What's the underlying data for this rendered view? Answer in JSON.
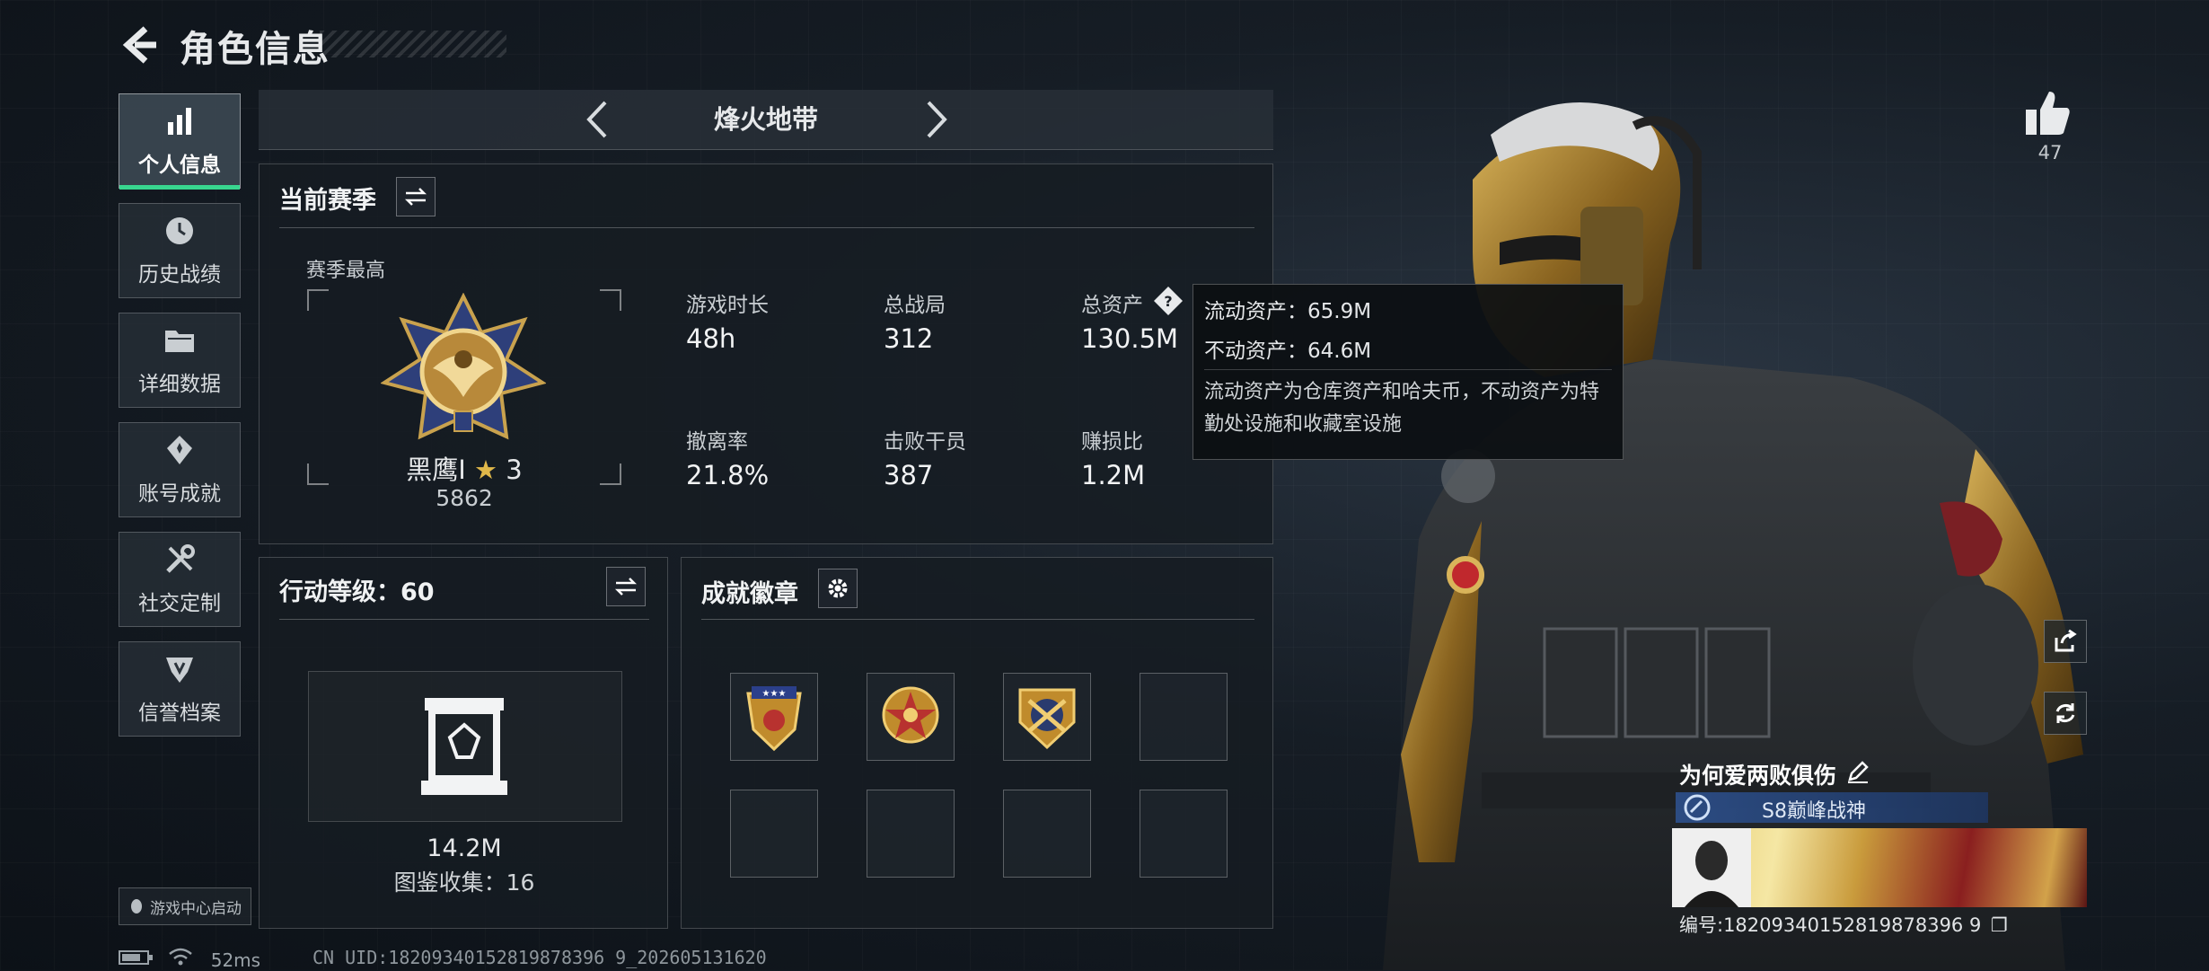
{
  "header": {
    "title": "角色信息"
  },
  "nav": {
    "items": [
      {
        "label": "个人信息",
        "icon": "bar-chart-icon",
        "active": true
      },
      {
        "label": "历史战绩",
        "icon": "history-icon"
      },
      {
        "label": "详细数据",
        "icon": "folder-icon"
      },
      {
        "label": "账号成就",
        "icon": "achievement-icon"
      },
      {
        "label": "社交定制",
        "icon": "tools-icon"
      },
      {
        "label": "信誉档案",
        "icon": "shield-badge-icon"
      }
    ],
    "game_center": "游戏中心启动"
  },
  "mode": {
    "name": "烽火地带"
  },
  "season": {
    "title": "当前赛季",
    "peak_label": "赛季最高",
    "rank_name": "黑鹰I",
    "rank_stars": "3",
    "rank_points": "5862",
    "stats": [
      {
        "label": "游戏时长",
        "value": "48h"
      },
      {
        "label": "总战局",
        "value": "312"
      },
      {
        "label": "总资产",
        "value": "130.5M"
      },
      {
        "label": "撤离率",
        "value": "21.8%"
      },
      {
        "label": "击败干员",
        "value": "387"
      },
      {
        "label": "赚损比",
        "value": "1.2M"
      }
    ]
  },
  "tooltip": {
    "liquid": "流动资产：65.9M",
    "fixed": "不动资产：64.6M",
    "description": "流动资产为仓库资产和哈夫币，不动资产为特勤处设施和收藏室设施"
  },
  "level": {
    "title": "行动等级：60",
    "value": "14.2M",
    "collection": "图鉴收集：16"
  },
  "badges": {
    "title": "成就徽章",
    "slots_filled": 3,
    "slots_total": 8
  },
  "profile": {
    "likes": "47",
    "player_name": "为何爱两败俱伤",
    "title": "S8巅峰战神",
    "card_uid": "编号:18209340152819878396 9"
  },
  "status": {
    "ping": "52ms",
    "uid": "CN UID:18209340152819878396 9_202605131620"
  },
  "colors": {
    "accent_green": "#38d68f",
    "title_blue": "#2d508c"
  }
}
